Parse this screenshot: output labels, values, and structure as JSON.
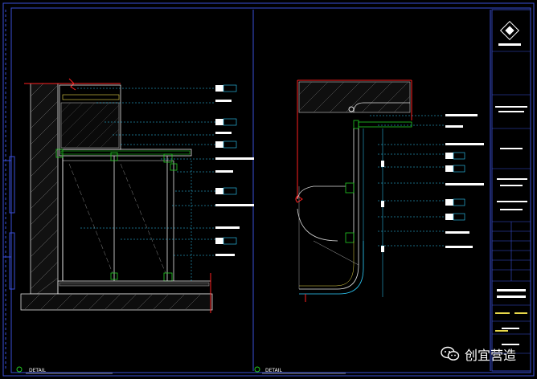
{
  "drawing": {
    "left_panel": {
      "title": "DETAIL",
      "notes": [
        "",
        "",
        "",
        "",
        "",
        "",
        "",
        "",
        "",
        ""
      ]
    },
    "right_panel": {
      "title": "DETAIL",
      "notes": [
        "",
        "",
        "",
        "",
        "",
        "",
        "",
        "",
        "",
        ""
      ]
    },
    "title_block": {
      "rows": 12
    }
  },
  "watermark": {
    "text": "创宜营造",
    "icon": "wechat-icon"
  },
  "colors": {
    "frame_blue": "#3a4fd8",
    "line_white": "#e6e6e6",
    "accent_red": "#ff2020",
    "accent_green": "#22cc22",
    "accent_cyan": "#2fd0ff",
    "accent_yellow": "#e8d84a"
  }
}
